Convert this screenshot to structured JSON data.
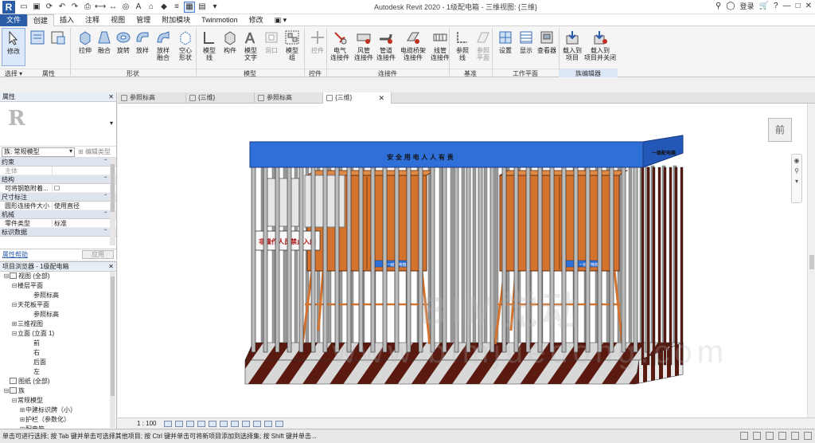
{
  "window": {
    "title": "Autodesk Revit 2020 - 1级配电箱 - 三维视图: {三维}",
    "search_icon": "binoculars-icon",
    "signin": "登录"
  },
  "menu": {
    "tabs": [
      "文件",
      "创建",
      "插入",
      "注释",
      "视图",
      "管理",
      "附加模块",
      "Twinmotion",
      "修改"
    ],
    "active": "创建"
  },
  "ribbon": {
    "buttons": [
      {
        "label": "修改",
        "icon": "cursor-icon"
      },
      {
        "label": "拉伸",
        "icon": "extrude-icon"
      },
      {
        "label": "融合",
        "icon": "blend-icon"
      },
      {
        "label": "旋转",
        "icon": "revolve-icon"
      },
      {
        "label": "放样",
        "icon": "sweep-icon"
      },
      {
        "label": "放样\n融合",
        "icon": "swept-blend-icon"
      },
      {
        "label": "空心\n形状",
        "icon": "void-icon"
      },
      {
        "label": "模型\n线",
        "icon": "model-line-icon"
      },
      {
        "label": "构件",
        "icon": "component-icon"
      },
      {
        "label": "模型\n文字",
        "icon": "model-text-icon"
      },
      {
        "label": "洞口",
        "icon": "opening-icon"
      },
      {
        "label": "模型\n组",
        "icon": "model-group-icon"
      },
      {
        "label": "控件",
        "icon": "control-icon"
      },
      {
        "label": "电气\n连接件",
        "icon": "electrical-connector-icon"
      },
      {
        "label": "风管\n连接件",
        "icon": "duct-connector-icon"
      },
      {
        "label": "管道\n连接件",
        "icon": "pipe-connector-icon"
      },
      {
        "label": "电缆桥架\n连接件",
        "icon": "cable-tray-connector-icon"
      },
      {
        "label": "线管\n连接件",
        "icon": "conduit-connector-icon"
      },
      {
        "label": "参照\n线",
        "icon": "reference-line-icon"
      },
      {
        "label": "参照\n平面",
        "icon": "reference-plane-icon"
      },
      {
        "label": "设置",
        "icon": "set-workplane-icon"
      },
      {
        "label": "显示",
        "icon": "show-workplane-icon"
      },
      {
        "label": "查看器",
        "icon": "viewer-icon"
      },
      {
        "label": "载入到\n项目",
        "icon": "load-into-project-icon"
      },
      {
        "label": "载入到\n项目并关闭",
        "icon": "load-close-icon"
      }
    ],
    "panels": [
      "选择 ▾",
      "属性",
      "形状",
      "模型",
      "控件",
      "连接件",
      "基准",
      "工作平面",
      "族编辑器"
    ]
  },
  "properties": {
    "title": "属性",
    "family_type": "族: 常规模型",
    "edit_type": "编辑类型",
    "rows": [
      {
        "cat": "约束"
      },
      {
        "k": "主体",
        "v": "",
        "gray": true
      },
      {
        "cat": "结构"
      },
      {
        "k": "可将钢筋附着...",
        "v": "☐"
      },
      {
        "cat": "尺寸标注"
      },
      {
        "k": "圆形连接件大小",
        "v": "使用直径"
      },
      {
        "cat": "机械"
      },
      {
        "k": "零件类型",
        "v": "标准"
      },
      {
        "cat": "标识数据"
      }
    ],
    "help": "属性帮助",
    "apply": "应用"
  },
  "browser": {
    "title": "项目浏览器 - 1级配电箱",
    "items": [
      {
        "label": "视图 (全部)",
        "indent": 0,
        "toggle": "⊟",
        "icon": true
      },
      {
        "label": "楼层平面",
        "indent": 1,
        "toggle": "⊟"
      },
      {
        "label": "参照标高",
        "indent": 3,
        "toggle": ""
      },
      {
        "label": "天花板平面",
        "indent": 1,
        "toggle": "⊟"
      },
      {
        "label": "参照标高",
        "indent": 3,
        "toggle": ""
      },
      {
        "label": "三维视图",
        "indent": 1,
        "toggle": "⊞"
      },
      {
        "label": "立面 (立面 1)",
        "indent": 1,
        "toggle": "⊟"
      },
      {
        "label": "前",
        "indent": 3,
        "toggle": ""
      },
      {
        "label": "右",
        "indent": 3,
        "toggle": ""
      },
      {
        "label": "后面",
        "indent": 3,
        "toggle": ""
      },
      {
        "label": "左",
        "indent": 3,
        "toggle": ""
      },
      {
        "label": "图纸 (全部)",
        "indent": 0,
        "toggle": "",
        "icon": true
      },
      {
        "label": "族",
        "indent": 0,
        "toggle": "⊟",
        "icon": true
      },
      {
        "label": "常规模型",
        "indent": 1,
        "toggle": "⊟"
      },
      {
        "label": "中建标识牌（小）",
        "indent": 2,
        "toggle": "⊞"
      },
      {
        "label": "护栏（参数化）",
        "indent": 2,
        "toggle": "⊞"
      },
      {
        "label": "配电箱",
        "indent": 2,
        "toggle": "⊞"
      }
    ]
  },
  "view_tabs": [
    {
      "label": "参照标高",
      "active": false
    },
    {
      "label": "{三维}",
      "active": false
    },
    {
      "label": "参照标高",
      "active": false
    },
    {
      "label": "{三维}",
      "active": true
    }
  ],
  "canvas": {
    "sign_top": "安 全 用 电   人 人 有 责",
    "sign_side": "一级配电箱",
    "warning": "非操作人员禁止入内",
    "box_label": "一级配电箱",
    "viewcube": "前",
    "watermark": "BIM觉动",
    "watermark2": "www.bimjuedong.com",
    "colors": {
      "roof": "#2f6fd8",
      "box": "#d4732e",
      "stripe_dark": "#5a1a10",
      "stripe_light": "#d8d8d8"
    }
  },
  "viewbar": {
    "scale": "1 : 100"
  },
  "status": {
    "text": "单击可进行选择; 按 Tab 键并单击可选择其他项目; 按 Ctrl 键并单击可将新项目添加到选择集; 按 Shift 键并单击..."
  }
}
